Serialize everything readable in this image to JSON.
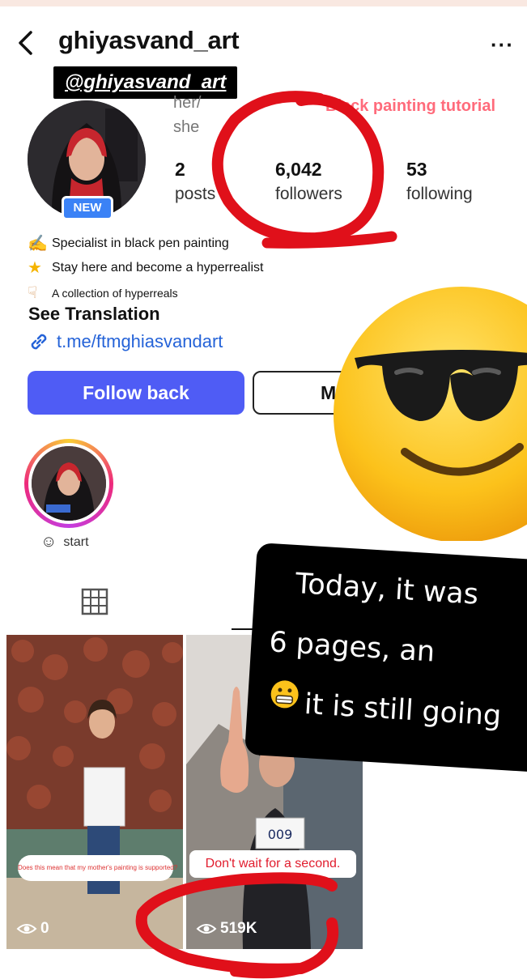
{
  "header": {
    "username": "ghiyasvand_art",
    "handle_tag": "@ghiyasvand_art"
  },
  "profile": {
    "new_badge": "NEW",
    "pronoun_line1": "her/",
    "pronoun_line2": "she",
    "overlay_caption": "Black painting tutorial"
  },
  "stats": {
    "posts": {
      "count": "2",
      "label": "posts"
    },
    "followers": {
      "count": "6,042",
      "label": "followers"
    },
    "following": {
      "count": "53",
      "label": "following"
    }
  },
  "bio": {
    "lines": [
      {
        "icon": "writing-hand-icon",
        "text": "Specialist in black pen painting"
      },
      {
        "icon": "sparkle-star-icon",
        "text": "Stay here and become a hyperrealist"
      },
      {
        "icon": "pointing-down-icon",
        "text": "A collection of hyperreals"
      }
    ],
    "see_translation": "See Translation",
    "link": "t.me/ftmghiasvandart"
  },
  "actions": {
    "follow_back": "Follow back",
    "message_visible": "M"
  },
  "highlight": {
    "label": "start",
    "icon": "smiling-face-hearts-icon"
  },
  "overlay_card": {
    "line1": "Today, it was",
    "line2": "6 pages, an",
    "line3": "it is still going",
    "emoji": "grimacing-face-icon"
  },
  "posts": [
    {
      "caption": "Does this mean that my mother's painting is supported?",
      "views": "0"
    },
    {
      "caption": "Don't wait for a second.",
      "views": "519K"
    }
  ],
  "colors": {
    "follow_button": "#4f5cf5",
    "link": "#2563d8",
    "annotation_red": "#e0101a",
    "new_badge": "#3b82f6"
  }
}
